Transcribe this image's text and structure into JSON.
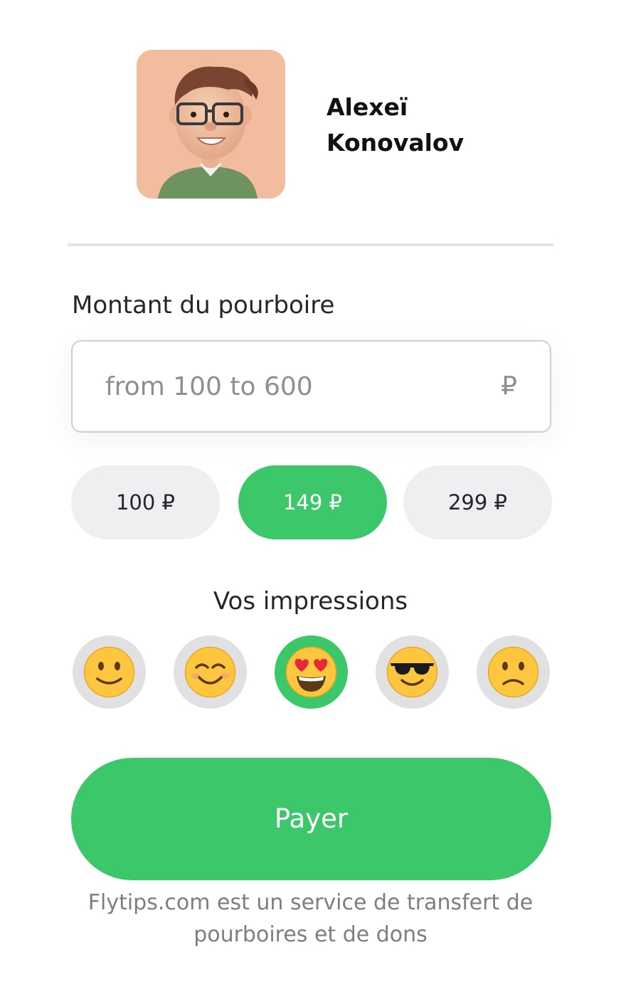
{
  "profile": {
    "name": "Alexeï Konovalov",
    "avatar_icon": "person-avatar-icon"
  },
  "amount": {
    "label": "Montant du pourboire",
    "placeholder": "from 100 to 600",
    "value": "",
    "currency": "₽"
  },
  "quick_amounts": [
    {
      "label": "100 ₽",
      "selected": false
    },
    {
      "label": "149 ₽",
      "selected": true
    },
    {
      "label": "299 ₽",
      "selected": false
    }
  ],
  "impressions": {
    "label": "Vos impressions",
    "options": [
      {
        "icon": "slightly-smiling-face-icon",
        "selected": false
      },
      {
        "icon": "smiling-face-with-smiling-eyes-icon",
        "selected": false
      },
      {
        "icon": "heart-eyes-face-icon",
        "selected": true
      },
      {
        "icon": "sunglasses-face-icon",
        "selected": false
      },
      {
        "icon": "slightly-frowning-face-icon",
        "selected": false
      }
    ]
  },
  "pay_button": {
    "label": "Payer"
  },
  "footer": {
    "text": "Flytips.com est un service de transfert de pourboires et de dons"
  },
  "colors": {
    "accent": "#3cc76b",
    "chip_bg": "#efeff2",
    "emoji_bg": "#e1e1e3",
    "avatar_bg": "#f1bd9e"
  }
}
